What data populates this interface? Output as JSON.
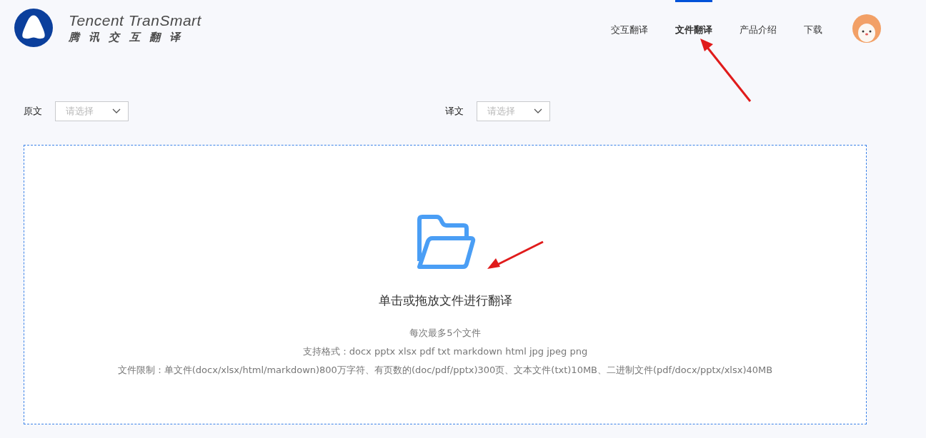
{
  "logo": {
    "name": "Tencent TranSmart",
    "subtitle": "腾 讯 交 互 翻 译"
  },
  "nav": [
    {
      "label": "交互翻译",
      "selected": false
    },
    {
      "label": "文件翻译",
      "selected": true
    },
    {
      "label": "产品介绍",
      "selected": false
    },
    {
      "label": "下载",
      "selected": false
    }
  ],
  "languages": [
    {
      "label": "原文",
      "placeholder": "请选择"
    },
    {
      "label": "译文",
      "placeholder": "请选择"
    }
  ],
  "upload": {
    "title": "单击或拖放文件进行翻译",
    "notes": [
      "每次最多5个文件",
      "支持格式：docx pptx xlsx pdf txt markdown html jpg jpeg png",
      "文件限制：单文件(docx/xlsx/html/markdown)800万字符、有页数的(doc/pdf/pptx)300页、文本文件(txt)10MB、二进制文件(pdf/docx/pptx/xlsx)40MB"
    ]
  }
}
